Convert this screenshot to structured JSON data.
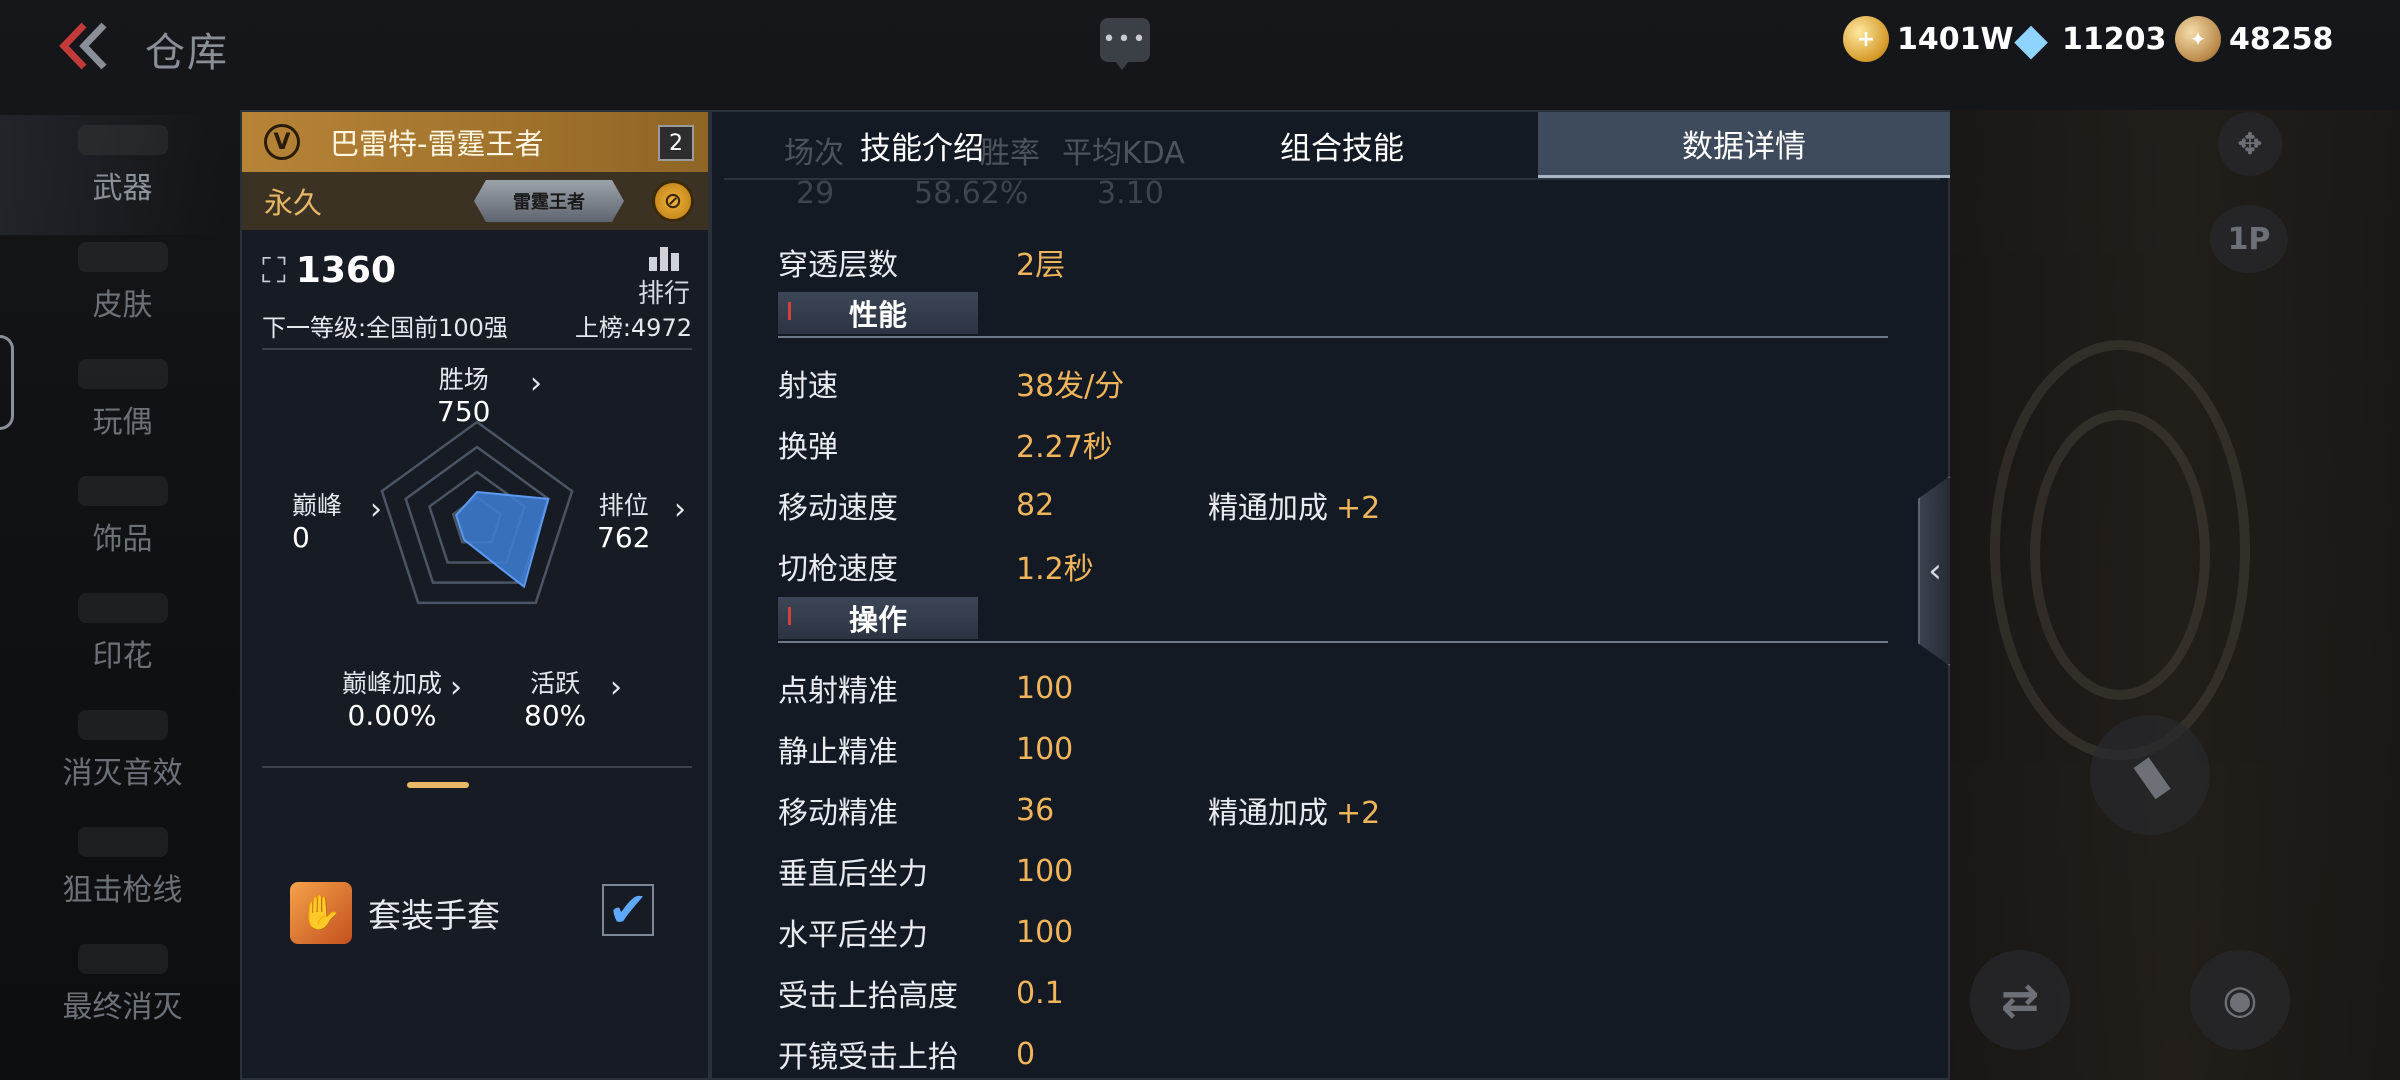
{
  "header": {
    "title": "仓库",
    "currencies": [
      {
        "icon": "gold-coin-icon",
        "value": "1401W"
      },
      {
        "icon": "diamond-icon",
        "value": "11203"
      },
      {
        "icon": "medal-icon",
        "value": "48258"
      }
    ]
  },
  "sidebar": {
    "items": [
      {
        "label": "武器",
        "active": true
      },
      {
        "label": "皮肤"
      },
      {
        "label": "玩偶"
      },
      {
        "label": "饰品"
      },
      {
        "label": "印花"
      },
      {
        "label": "消灭音效"
      },
      {
        "label": "狙击枪线"
      },
      {
        "label": "最终消灭"
      }
    ]
  },
  "weapon_card": {
    "name": "巴雷特-雷霆王者",
    "level": "2",
    "duration": "永久",
    "plate_text": "雷霆王者",
    "score": "1360",
    "rank_label": "排行",
    "next_level": "下一等级:全国前100强",
    "ranking": "上榜:4972",
    "stats": {
      "wins": {
        "label": "胜场",
        "value": "750"
      },
      "peak": {
        "label": "巅峰",
        "value": "0"
      },
      "rank": {
        "label": "排位",
        "value": "762"
      },
      "peak_bonus": {
        "label": "巅峰加成",
        "value": "0.00%"
      },
      "activity": {
        "label": "活跃",
        "value": "80%"
      }
    },
    "radar_levels": {
      "wins": 0.3,
      "rank": 0.75,
      "activity": 0.8,
      "peak_bonus": 0.0,
      "peak": 0.0
    },
    "glove_label": "套装手套",
    "glove_checked": true
  },
  "tabs": [
    {
      "label": "技能介绍"
    },
    {
      "label": "组合技能"
    },
    {
      "label": "数据详情",
      "active": true
    }
  ],
  "background_stats": {
    "headers": [
      "场次",
      "胜率",
      "平均KDA"
    ],
    "values": [
      "29",
      "58.62%",
      "3.10"
    ]
  },
  "details": {
    "penetration": {
      "label": "穿透层数",
      "value": "2层"
    },
    "sections": [
      {
        "title": "性能",
        "rows": [
          {
            "label": "射速",
            "value": "38发/分"
          },
          {
            "label": "换弹",
            "value": "2.27秒"
          },
          {
            "label": "移动速度",
            "value": "82",
            "bonus_label": "精通加成",
            "bonus": "+2"
          },
          {
            "label": "切枪速度",
            "value": "1.2秒"
          }
        ]
      },
      {
        "title": "操作",
        "rows": [
          {
            "label": "点射精准",
            "value": "100"
          },
          {
            "label": "静止精准",
            "value": "100"
          },
          {
            "label": "移动精准",
            "value": "36",
            "bonus_label": "精通加成",
            "bonus": "+2"
          },
          {
            "label": "垂直后坐力",
            "value": "100"
          },
          {
            "label": "水平后坐力",
            "value": "100"
          },
          {
            "label": "受击上抬高度",
            "value": "0.1"
          },
          {
            "label": "开镜受击上抬",
            "value": "0"
          }
        ]
      }
    ]
  },
  "right_controls": {
    "first_person_label": "1P"
  },
  "colors": {
    "accent_gold": "#f0b55a",
    "card_header": "#b78437",
    "active_tab": "#3e4b5c",
    "checkbox": "#5fa8ff"
  }
}
